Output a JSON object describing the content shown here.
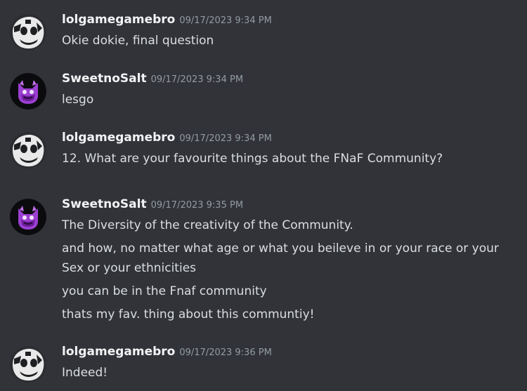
{
  "messages": [
    {
      "username": "lolgamegamebro",
      "avatar": "white-robot-avatar-icon",
      "timestamp": "09/17/2023 9:34 PM",
      "lines": [
        "Okie dokie, final question"
      ]
    },
    {
      "username": "SweetnoSalt",
      "avatar": "purple-cat-avatar-icon",
      "timestamp": "09/17/2023 9:34 PM",
      "lines": [
        "lesgo"
      ]
    },
    {
      "username": "lolgamegamebro",
      "avatar": "white-robot-avatar-icon",
      "timestamp": "09/17/2023 9:34 PM",
      "lines": [
        "12. What are your favourite things about the FNaF Community?"
      ]
    },
    {
      "username": "SweetnoSalt",
      "avatar": "purple-cat-avatar-icon",
      "timestamp": "09/17/2023 9:35 PM",
      "lines": [
        "The Diversity of the creativity of the Community.",
        "and how, no matter what age or what you beileve in or your race or your",
        "Sex or your ethnicities",
        "you can be in the Fnaf community",
        "thats my fav. thing about this communtiy!"
      ]
    },
    {
      "username": "lolgamegamebro",
      "avatar": "white-robot-avatar-icon",
      "timestamp": "09/17/2023 9:36 PM",
      "lines": [
        "Indeed!"
      ]
    }
  ],
  "colors": {
    "background": "#313338",
    "username": "#f2f3f5",
    "timestamp": "#949ba4",
    "text": "#dbdee1"
  }
}
